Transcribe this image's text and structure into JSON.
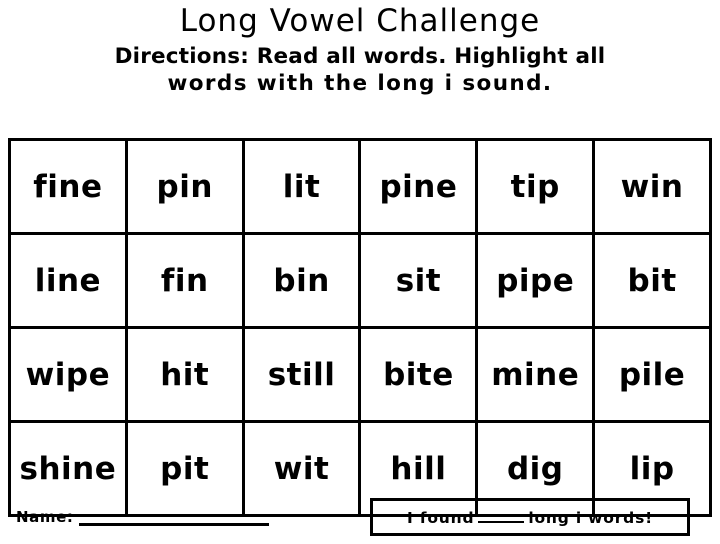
{
  "worksheet": {
    "title": "Long Vowel Challenge",
    "directions_line1": "Directions: Read all words. Highlight all",
    "directions_line2": "words with the long i sound.",
    "grid": {
      "rows": [
        [
          "fine",
          "pin",
          "lit",
          "pine",
          "tip",
          "win"
        ],
        [
          "line",
          "fin",
          "bin",
          "sit",
          "pipe",
          "bit"
        ],
        [
          "wipe",
          "hit",
          "still",
          "bite",
          "mine",
          "pile"
        ],
        [
          "shine",
          "pit",
          "wit",
          "hill",
          "dig",
          "lip"
        ]
      ]
    },
    "footer": {
      "name_label": "Name:",
      "found_prefix": "I found",
      "found_suffix": "long i words!"
    }
  }
}
